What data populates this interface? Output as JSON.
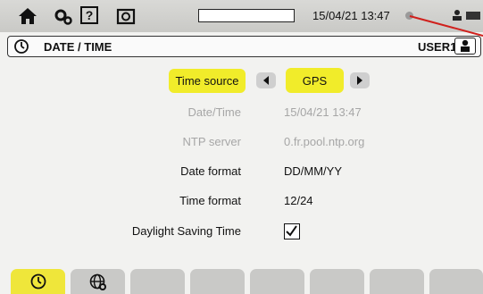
{
  "status_bar": {
    "icons": [
      "home-icon",
      "tools-icon",
      "help-icon",
      "camera-icon"
    ],
    "help_glyph": "?",
    "datetime": "15/04/21 13:47",
    "right_icons": [
      "network-status-icon",
      "user-icon",
      "battery-icon"
    ]
  },
  "header": {
    "icon": "clock-icon",
    "title": "DATE / TIME",
    "user": "USER1",
    "user_button_icon": "user-icon"
  },
  "settings": {
    "time_source": {
      "label": "Time source",
      "value": "GPS",
      "prev_icon": "arrow-left-icon",
      "next_icon": "arrow-right-icon"
    },
    "date_time": {
      "label": "Date/Time",
      "value": "15/04/21 13:47"
    },
    "ntp_server": {
      "label": "NTP server",
      "value": "0.fr.pool.ntp.org"
    },
    "date_format": {
      "label": "Date format",
      "value": "DD/MM/YY"
    },
    "time_format": {
      "label": "Time format",
      "value": "12/24"
    },
    "daylight_saving": {
      "label": "Daylight Saving Time",
      "checked": true
    }
  },
  "tabs": [
    {
      "icon": "clock-icon",
      "active": true
    },
    {
      "icon": "globe-icon",
      "active": false
    },
    {
      "icon": "",
      "active": false
    },
    {
      "icon": "",
      "active": false
    },
    {
      "icon": "",
      "active": false
    },
    {
      "icon": "",
      "active": false
    },
    {
      "icon": "",
      "active": false
    },
    {
      "icon": "",
      "active": false
    }
  ],
  "colors": {
    "highlight": "#f1ec2a",
    "active_tab": "#efe63a",
    "disabled_text": "#a6a6a6",
    "red_indicator": "#d0201c"
  }
}
